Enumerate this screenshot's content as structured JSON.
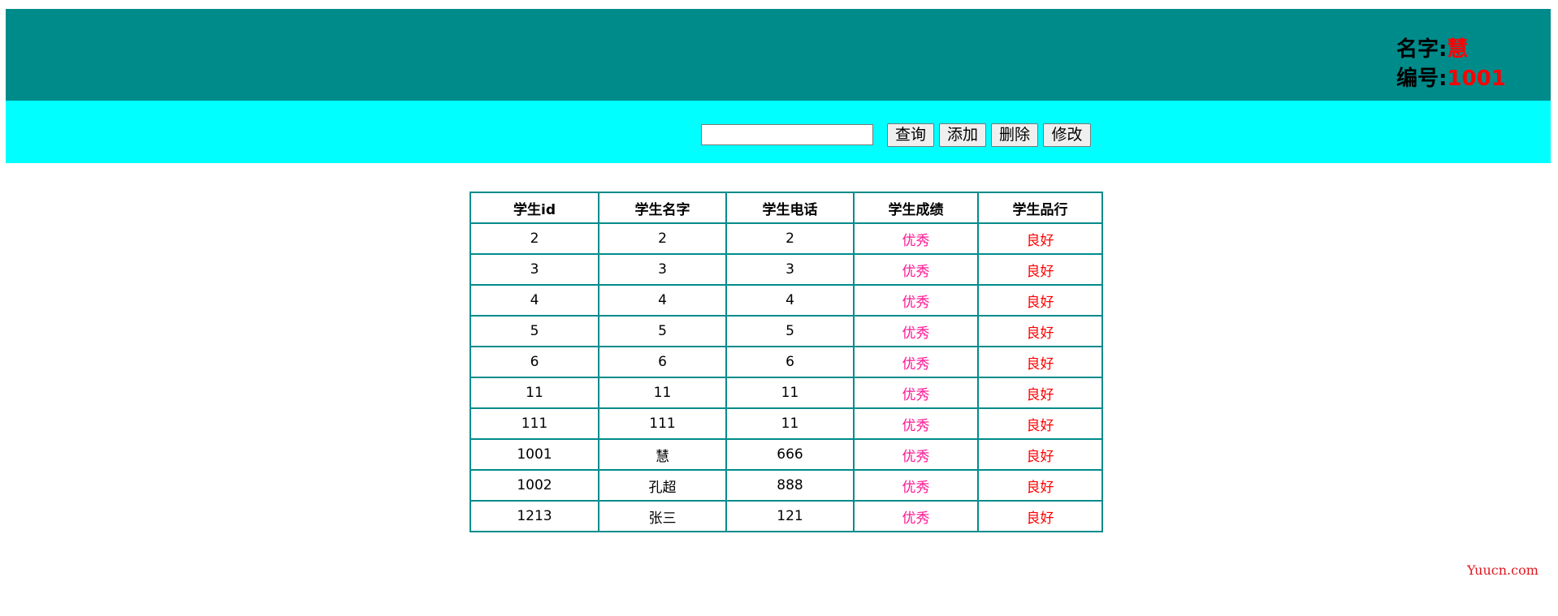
{
  "header": {
    "name_label": "名字:",
    "name_value": "慧",
    "id_label": "编号:",
    "id_value": "1001",
    "background_color": "#008b8b"
  },
  "toolbar": {
    "background_color": "#00ffff",
    "search_value": "",
    "buttons": {
      "query": "查询",
      "add": "添加",
      "delete": "删除",
      "edit": "修改"
    }
  },
  "table": {
    "columns": [
      "学生id",
      "学生名字",
      "学生电话",
      "学生成绩",
      "学生品行"
    ],
    "rows": [
      [
        "2",
        "2",
        "2",
        "优秀",
        "良好"
      ],
      [
        "3",
        "3",
        "3",
        "优秀",
        "良好"
      ],
      [
        "4",
        "4",
        "4",
        "优秀",
        "良好"
      ],
      [
        "5",
        "5",
        "5",
        "优秀",
        "良好"
      ],
      [
        "6",
        "6",
        "6",
        "优秀",
        "良好"
      ],
      [
        "11",
        "11",
        "11",
        "优秀",
        "良好"
      ],
      [
        "111",
        "111",
        "11",
        "优秀",
        "良好"
      ],
      [
        "1001",
        "慧",
        "666",
        "优秀",
        "良好"
      ],
      [
        "1002",
        "孔超",
        "888",
        "优秀",
        "良好"
      ],
      [
        "1213",
        "张三",
        "121",
        "优秀",
        "良好"
      ]
    ],
    "border_color": "#008b8b",
    "grade_color": "#ff1493",
    "conduct_color": "#ff0000"
  },
  "watermark": {
    "text": "Yuucn.com",
    "color": "#e0161e"
  }
}
